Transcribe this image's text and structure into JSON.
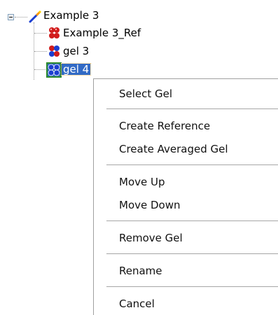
{
  "tree": {
    "root": {
      "label": "Example 3",
      "icon": "wand-icon",
      "expanded": true
    },
    "children": [
      {
        "label": "Example 3_Ref",
        "icon": "gel-ref-icon",
        "selected": false
      },
      {
        "label": "gel 3",
        "icon": "gel-icon",
        "selected": false
      },
      {
        "label": "gel 4",
        "icon": "gel-icon",
        "selected": true
      }
    ]
  },
  "context_menu": {
    "items": [
      {
        "label": "Select Gel"
      },
      {
        "label": "Create Reference"
      },
      {
        "label": "Create Averaged Gel"
      },
      {
        "label": "Move Up"
      },
      {
        "label": "Move Down"
      },
      {
        "label": "Remove Gel"
      },
      {
        "label": "Rename"
      },
      {
        "label": "Cancel"
      }
    ]
  },
  "colors": {
    "selection": "#316ac5",
    "gel_red": "#d11c1c",
    "gel_blue": "#1c3fd1"
  }
}
